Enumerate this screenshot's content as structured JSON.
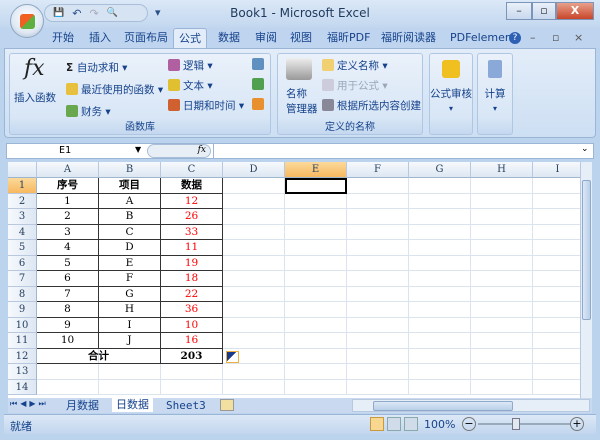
{
  "window": {
    "title": "Book1 - Microsoft Excel",
    "minimize": "–",
    "restore": "▫",
    "close": "X"
  },
  "qat": {
    "save": "💾",
    "undo": "↶",
    "redo": "↷",
    "preview": "🔍",
    "more": "▾"
  },
  "tabs": [
    "开始",
    "插入",
    "页面布局",
    "公式",
    "数据",
    "审阅",
    "视图",
    "福昕PDF",
    "福昕阅读器",
    "PDFelement"
  ],
  "active_tab": "公式",
  "ribbon": {
    "insert_function": "插入函数",
    "fx": "fx",
    "autosum": "自动求和",
    "recent": "最近使用的函数",
    "financial": "财务",
    "logical": "逻辑",
    "text": "文本",
    "datetime": "日期和时间",
    "group1": "函数库",
    "name_manager_1": "名称",
    "name_manager_2": "管理器",
    "define_name": "定义名称",
    "use_in_formula": "用于公式",
    "create_from_selection": "根据所选内容创建",
    "group2": "定义的名称",
    "formula_auditing": "公式审核",
    "calculation": "计算"
  },
  "formula_bar": {
    "name_box": "E1",
    "fx": "fx",
    "value": ""
  },
  "columns": [
    "A",
    "B",
    "C",
    "D",
    "E",
    "F",
    "G",
    "H",
    "I"
  ],
  "rows": [
    "1",
    "2",
    "3",
    "4",
    "5",
    "6",
    "7",
    "8",
    "9",
    "10",
    "11",
    "12",
    "13",
    "14"
  ],
  "table": {
    "headers": [
      "序号",
      "项目",
      "数据"
    ],
    "data": [
      [
        "1",
        "A",
        "12"
      ],
      [
        "2",
        "B",
        "26"
      ],
      [
        "3",
        "C",
        "33"
      ],
      [
        "4",
        "D",
        "11"
      ],
      [
        "5",
        "E",
        "19"
      ],
      [
        "6",
        "F",
        "18"
      ],
      [
        "7",
        "G",
        "22"
      ],
      [
        "8",
        "H",
        "36"
      ],
      [
        "9",
        "I",
        "10"
      ],
      [
        "10",
        "J",
        "16"
      ]
    ],
    "total_label": "合计",
    "total_value": "203"
  },
  "sheets": [
    "月数据",
    "日数据",
    "Sheet3"
  ],
  "active_sheet": "日数据",
  "status": {
    "ready": "就绪",
    "zoom": "100%"
  },
  "colors": {
    "value_red": "#ff0000",
    "selected_header": "#f7b860"
  }
}
